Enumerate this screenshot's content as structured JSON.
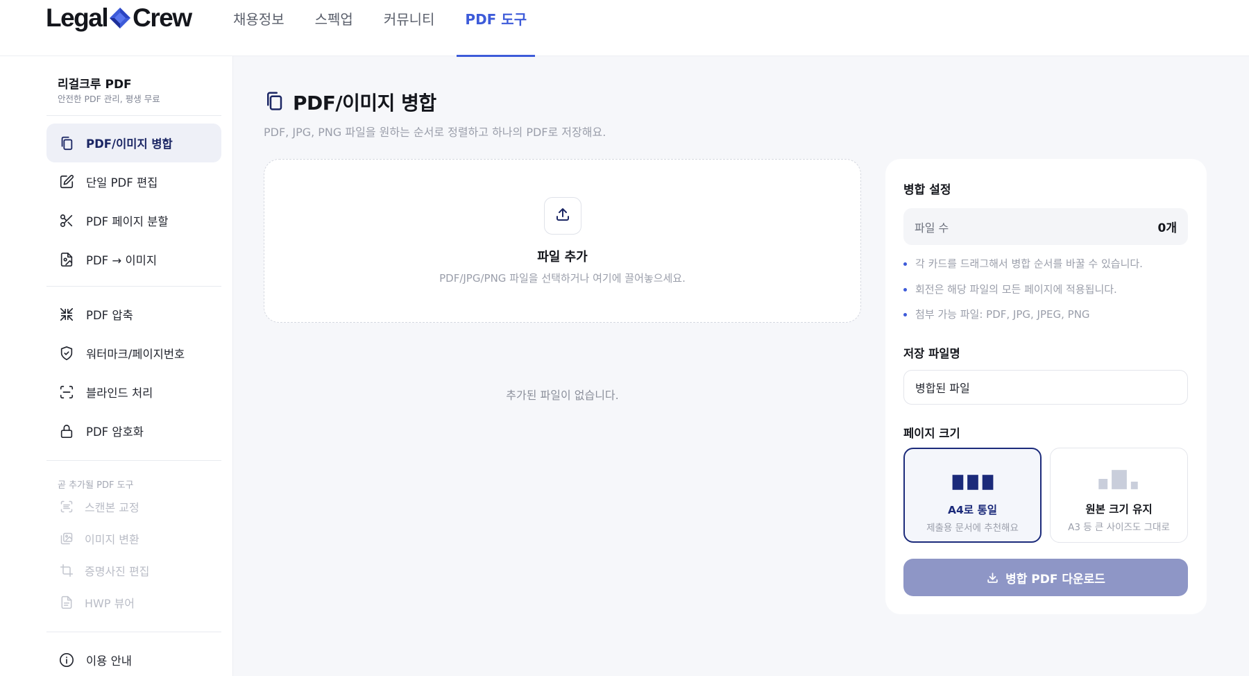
{
  "header": {
    "logo_left": "Legal",
    "logo_right": "Crew",
    "nav": [
      {
        "label": "채용정보"
      },
      {
        "label": "스펙업"
      },
      {
        "label": "커뮤니티"
      },
      {
        "label": "PDF 도구"
      }
    ],
    "active_nav": "PDF 도구"
  },
  "sidebar": {
    "title": "리걸크루 PDF",
    "subtitle": "안전한 PDF 관리, 평생 무료",
    "items": [
      {
        "label": "PDF/이미지 병합",
        "icon": "copy-icon",
        "active": true
      },
      {
        "label": "단일 PDF 편집",
        "icon": "edit-icon"
      },
      {
        "label": "PDF 페이지 분할",
        "icon": "scissors-icon"
      },
      {
        "label": "PDF → 이미지",
        "icon": "file-image-icon"
      },
      {
        "label": "PDF 압축",
        "icon": "compress-icon"
      },
      {
        "label": "워터마크/페이지번호",
        "icon": "shield-check-icon"
      },
      {
        "label": "블라인드 처리",
        "icon": "scan-icon"
      },
      {
        "label": "PDF 암호화",
        "icon": "lock-icon"
      }
    ],
    "coming_soon_label": "곧 추가될 PDF 도구",
    "coming_soon": [
      {
        "label": "스캔본 교정",
        "icon": "scan-text-icon"
      },
      {
        "label": "이미지 변환",
        "icon": "images-icon"
      },
      {
        "label": "증명사진 편집",
        "icon": "crop-icon"
      },
      {
        "label": "HWP 뷰어",
        "icon": "file-text-icon"
      }
    ],
    "help": {
      "label": "이용 안내",
      "icon": "info-icon"
    }
  },
  "main": {
    "title": "PDF/이미지 병합",
    "description": "PDF, JPG, PNG 파일을 원하는 순서로 정렬하고 하나의 PDF로 저장해요.",
    "dropzone": {
      "title": "파일 추가",
      "hint": "PDF/JPG/PNG 파일을 선택하거나 여기에 끌어놓으세요."
    },
    "empty_message": "추가된 파일이 없습니다."
  },
  "settings": {
    "title": "병합 설정",
    "file_count_label": "파일 수",
    "file_count_value": "0개",
    "tips": [
      "각 카드를 드래그해서 병합 순서를 바꿀 수 있습니다.",
      "회전은 해당 파일의 모든 페이지에 적용됩니다.",
      "첨부 가능 파일: PDF, JPG, JPEG, PNG"
    ],
    "filename_label": "저장 파일명",
    "filename_value": "병합된 파일",
    "page_size_label": "페이지 크기",
    "page_size_options": [
      {
        "title": "A4로 통일",
        "subtitle": "제출용 문서에 추천해요",
        "selected": true
      },
      {
        "title": "원본 크기 유지",
        "subtitle": "A3 등 큰 사이즈도 그대로",
        "selected": false
      }
    ],
    "download_label": "병합 PDF 다운로드"
  },
  "colors": {
    "accent": "#3d5bd9",
    "navy": "#1b2a7a",
    "button_disabled": "#8e96c6"
  }
}
